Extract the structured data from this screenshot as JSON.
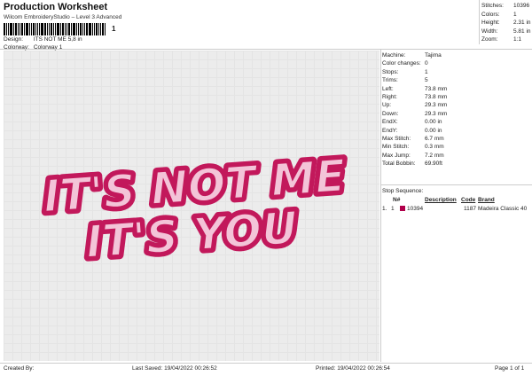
{
  "header": {
    "title": "Production Worksheet",
    "subtitle": "Wilcom EmbroideryStudio – Level 3 Advanced",
    "barcode_number": "1"
  },
  "design_info": {
    "design_label": "Design:",
    "design_value": "ITS NOT ME 5,8 in",
    "colorway_label": "Colorway:",
    "colorway_value": "Colorway 1"
  },
  "summary": [
    {
      "label": "Stitches:",
      "value": "10396"
    },
    {
      "label": "Colors:",
      "value": "1"
    },
    {
      "label": "Height:",
      "value": "2.31 in"
    },
    {
      "label": "Width:",
      "value": "5.81 in"
    },
    {
      "label": "Zoom:",
      "value": "1:1"
    }
  ],
  "artwork": {
    "line1": "IT'S NOT ME",
    "line2": "IT'S YOU",
    "fill_color": "#f3c4d8",
    "outline_color": "#c2185b"
  },
  "machine_details": [
    {
      "label": "Machine:",
      "value": "Tajima"
    },
    {
      "label": "Color changes:",
      "value": "0"
    },
    {
      "label": "Stops:",
      "value": "1"
    },
    {
      "label": "Trims:",
      "value": "5"
    },
    {
      "label": "Left:",
      "value": "73.8 mm"
    },
    {
      "label": "Right:",
      "value": "73.8 mm"
    },
    {
      "label": "Up:",
      "value": "29.3 mm"
    },
    {
      "label": "Down:",
      "value": "29.3 mm"
    },
    {
      "label": "EndX:",
      "value": "0.00 in"
    },
    {
      "label": "EndY:",
      "value": "0.00 in"
    },
    {
      "label": "Max Stitch:",
      "value": "6.7 mm"
    },
    {
      "label": "Min Stitch:",
      "value": "0.3 mm"
    },
    {
      "label": "Max Jump:",
      "value": "7.2 mm"
    },
    {
      "label": "Total Bobbin:",
      "value": "69.90ft"
    }
  ],
  "stop_sequence": {
    "label": "Stop Sequence:",
    "headers": {
      "n": "N#",
      "description": "Description",
      "code": "Code",
      "brand": "Brand"
    },
    "rows": [
      {
        "index": "1.",
        "n": "1",
        "description": "10394",
        "code": "1187",
        "brand": "Madeira Classic 40",
        "color": "#b0004a"
      }
    ]
  },
  "footer": {
    "created_by": "Created By:",
    "last_saved": "Last Saved: 19/04/2022 00:26:52",
    "printed": "Printed: 19/04/2022 00:26:54",
    "page": "Page 1 of 1"
  }
}
